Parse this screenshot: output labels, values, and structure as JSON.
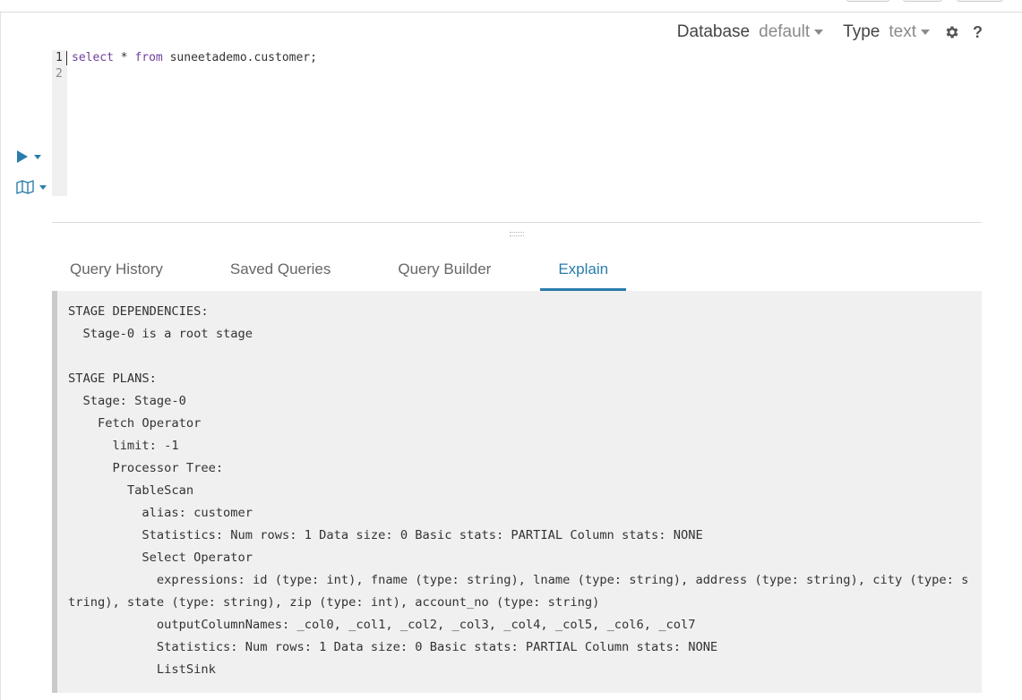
{
  "toolbar": {
    "database_label": "Database",
    "database_value": "default",
    "type_label": "Type",
    "type_value": "text",
    "help_label": "?"
  },
  "editor": {
    "line_numbers": [
      "1",
      "2"
    ],
    "query_line": {
      "kw_select": "select",
      "star": " * ",
      "kw_from": "from",
      "rest": " suneetademo.customer;"
    }
  },
  "icons": {
    "run": "play-icon",
    "run_menu": "caret-down-icon",
    "map": "map-icon",
    "settings": "gear-icon"
  },
  "colors": {
    "accent": "#2a7cab",
    "keyword": "#6f3f9b"
  },
  "tabs": [
    {
      "label": "Query History"
    },
    {
      "label": "Saved Queries"
    },
    {
      "label": "Query Builder"
    },
    {
      "label": "Explain",
      "active": true
    }
  ],
  "explain": {
    "text": "STAGE DEPENDENCIES:\n  Stage-0 is a root stage\n\nSTAGE PLANS:\n  Stage: Stage-0\n    Fetch Operator\n      limit: -1\n      Processor Tree:\n        TableScan\n          alias: customer\n          Statistics: Num rows: 1 Data size: 0 Basic stats: PARTIAL Column stats: NONE\n          Select Operator\n            expressions: id (type: int), fname (type: string), lname (type: string), address (type: string), city (type: string), state (type: string), zip (type: int), account_no (type: string)\n            outputColumnNames: _col0, _col1, _col2, _col3, _col4, _col5, _col6, _col7\n            Statistics: Num rows: 1 Data size: 0 Basic stats: PARTIAL Column stats: NONE\n            ListSink"
  }
}
